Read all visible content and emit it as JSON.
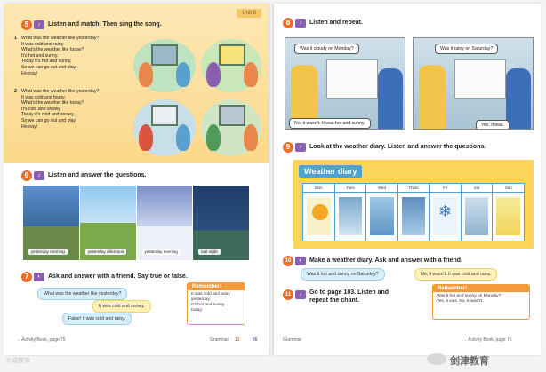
{
  "left_page": {
    "unit_tab": "Unit 8",
    "ex5": {
      "num": "5",
      "instruction": "Listen and match. Then sing the song."
    },
    "song1": {
      "no": "1",
      "lines": [
        "What was the weather like yesterday?",
        "It was cold and rainy.",
        "What's the weather like today?",
        "It's hot and sunny.",
        "Today it's hot and sunny,",
        "So we can go out and play.",
        "Hooray!"
      ]
    },
    "song2": {
      "no": "2",
      "lines": [
        "What was the weather like yesterday?",
        "It was cold and foggy.",
        "What's the weather like today?",
        "It's cold and snowy.",
        "Today it's cold and snowy,",
        "So we can go out and play.",
        "Hooray!"
      ]
    },
    "scene_labels": [
      "a",
      "b",
      "c",
      "d"
    ],
    "ex6": {
      "num": "6",
      "instruction": "Listen and answer the questions."
    },
    "photos": [
      {
        "label": "yesterday morning"
      },
      {
        "label": "yesterday afternoon"
      },
      {
        "label": "yesterday evening"
      },
      {
        "label": "last night"
      }
    ],
    "ex7": {
      "num": "7",
      "instruction": "Ask and answer with a friend. Say true or false."
    },
    "bubbles": {
      "q": "What was the weather like yesterday?",
      "a": "It was cold and snowy.",
      "b": "False! It was cold and rainy."
    },
    "remember": {
      "title": "Remember!",
      "lines": [
        "It was cold and rainy",
        "yesterday.",
        "It's hot and sunny",
        "today."
      ]
    },
    "footer": {
      "activity": "→ Activity Book, page 75",
      "grammar": "Grammar",
      "page": "13",
      "page_num": "96"
    }
  },
  "right_page": {
    "ex8": {
      "num": "8",
      "instruction": "Listen and repeat."
    },
    "speech": {
      "q1": "Was it cloudy on Monday?",
      "a1": "No, it wasn't. It was hot and sunny.",
      "q2": "Was it rainy on Saturday?",
      "a2": "Yes, it was."
    },
    "ex9": {
      "num": "9",
      "instruction": "Look at the weather diary. Listen and answer the questions."
    },
    "diary": {
      "title": "Weather diary",
      "days": [
        "Mon",
        "Tues",
        "Wed",
        "Thurs",
        "Fri",
        "Sat",
        "Sun"
      ]
    },
    "ex10": {
      "num": "10",
      "instruction": "Make a weather diary. Ask and answer with a friend."
    },
    "bubbles": {
      "q": "Was it hot and sunny on Saturday?",
      "a": "No, it wasn't. It was cold and rainy."
    },
    "ex11": {
      "num": "11",
      "instruction_1": "Go to page 103. Listen and",
      "instruction_2": "repeat the chant."
    },
    "remember": {
      "title": "Remember!",
      "lines": [
        "Was it hot and sunny on Monday?",
        "Yes, it was.   No, it wasn't."
      ]
    },
    "footer": {
      "grammar": "Grammar",
      "activity": "→ Activity Book, page 76"
    }
  },
  "watermarks": {
    "left": "大成教育",
    "right": "剑津教育"
  },
  "colors": {
    "orange": "#eb6f2a",
    "purple": "#8a5fb0",
    "blue": "#4fa3d4",
    "yellow": "#fbd55a"
  }
}
